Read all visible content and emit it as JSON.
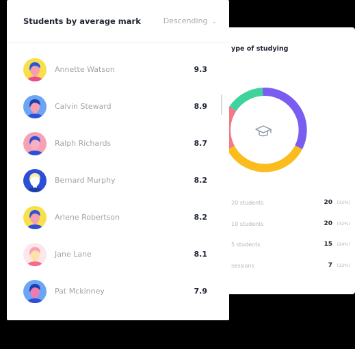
{
  "students_card": {
    "title": "Students by average mark",
    "sort_label": "Descending",
    "students": [
      {
        "name": "Annette Watson",
        "mark": "9.3",
        "avatar_bg": "#f9e04b",
        "hair": "#2a56d4",
        "skin": "#f59fb0",
        "shirt": "#e94d8a"
      },
      {
        "name": "Calvin Steward",
        "mark": "8.9",
        "avatar_bg": "#6aa6f5",
        "hair": "#1f3fa8",
        "skin": "#f59fb0",
        "shirt": "#2d4fd8"
      },
      {
        "name": "Ralph Richards",
        "mark": "8.7",
        "avatar_bg": "#f7a1b4",
        "hair": "#2d4fd8",
        "skin": "#f6b0be",
        "shirt": "#2d4fd8"
      },
      {
        "name": "Bernard Murphy",
        "mark": "8.2",
        "avatar_bg": "#2d4fd8",
        "hair": "#ffe9a8",
        "skin": "#ffffff",
        "shirt": "#1f3fa8"
      },
      {
        "name": "Arlene Robertson",
        "mark": "8.2",
        "avatar_bg": "#f9e04b",
        "hair": "#2a56d4",
        "skin": "#f59fb0",
        "shirt": "#2d4fd8"
      },
      {
        "name": "Jane Lane",
        "mark": "8.1",
        "avatar_bg": "#fde6ec",
        "hair": "#f7a1b4",
        "skin": "#fde2a8",
        "shirt": "#f56a8d"
      },
      {
        "name": "Pat Mckinney",
        "mark": "7.9",
        "avatar_bg": "#6aa6f5",
        "hair": "#1f3fa8",
        "skin": "#f07bb0",
        "shirt": "#2d4fd8"
      }
    ]
  },
  "studying_card": {
    "title": "ype of studying",
    "ring_colors": [
      "#3ed39c",
      "#7b5cf0",
      "#fbbd1e",
      "#f25a6b"
    ],
    "stats": [
      {
        "label": "20 students",
        "value": "20",
        "percent": "(32%)"
      },
      {
        "label": "10 students",
        "value": "20",
        "percent": "(32%)"
      },
      {
        "label": "5 students",
        "value": "15",
        "percent": "(24%)"
      },
      {
        "label": "sessions",
        "value": "7",
        "percent": "(12%)"
      }
    ]
  }
}
